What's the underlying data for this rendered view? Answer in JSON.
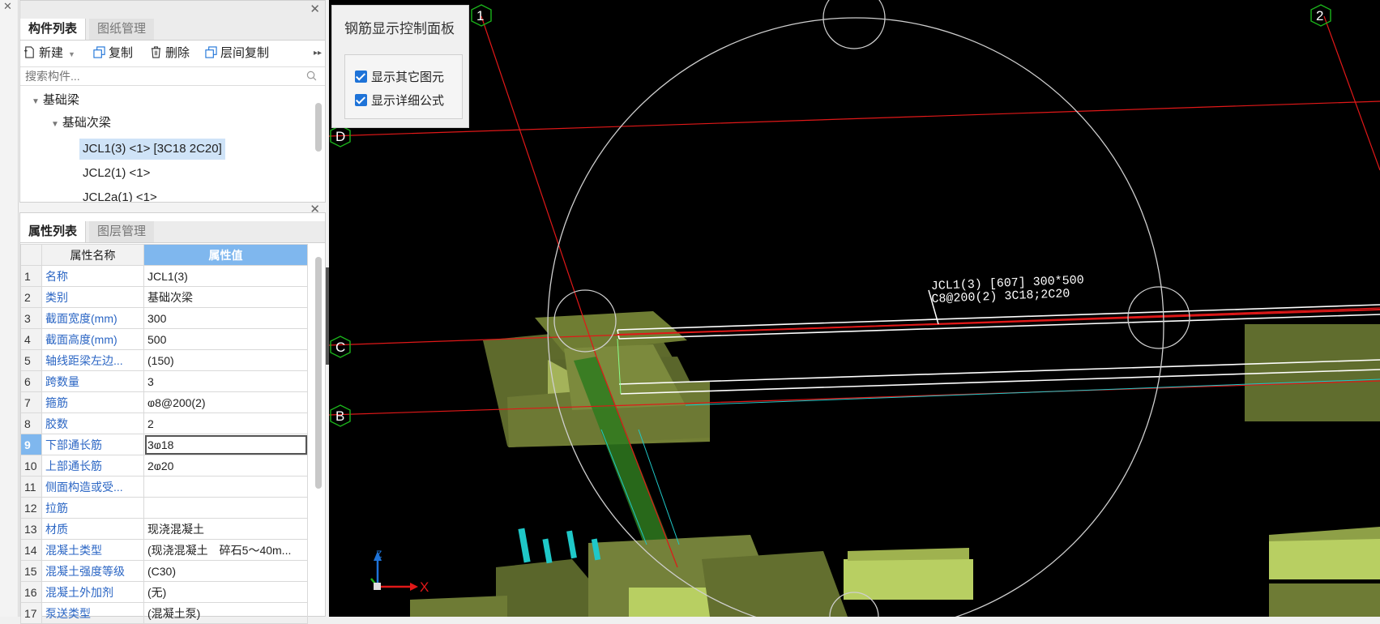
{
  "component_panel": {
    "tabs": [
      "构件列表",
      "图纸管理"
    ],
    "toolbar": {
      "new_label": "新建",
      "copy_label": "复制",
      "delete_label": "删除",
      "floor_copy_label": "层间复制"
    },
    "search_placeholder": "搜索构件...",
    "tree": {
      "root": "基础梁",
      "child": "基础次梁",
      "items": [
        "JCL1(3) <1> [3C18 2C20]",
        "JCL2(1) <1>",
        "JCL2a(1) <1>"
      ]
    }
  },
  "property_panel": {
    "tabs": [
      "属性列表",
      "图层管理"
    ],
    "col_name": "属性名称",
    "col_value": "属性值",
    "selected_row": 9,
    "rows": [
      {
        "n": "1",
        "name": "名称",
        "value": "JCL1(3)"
      },
      {
        "n": "2",
        "name": "类别",
        "value": "基础次梁"
      },
      {
        "n": "3",
        "name": "截面宽度(mm)",
        "value": "300"
      },
      {
        "n": "4",
        "name": "截面高度(mm)",
        "value": "500"
      },
      {
        "n": "5",
        "name": "轴线距梁左边...",
        "value": "(150)"
      },
      {
        "n": "6",
        "name": "跨数量",
        "value": "3"
      },
      {
        "n": "7",
        "name": "箍筋",
        "value": "ⱷ8@200(2)"
      },
      {
        "n": "8",
        "name": "胶数",
        "value": "2"
      },
      {
        "n": "9",
        "name": "下部通长筋",
        "value": "3ⱷ18"
      },
      {
        "n": "10",
        "name": "上部通长筋",
        "value": "2ⱷ20"
      },
      {
        "n": "11",
        "name": "侧面构造或受...",
        "value": ""
      },
      {
        "n": "12",
        "name": "拉筋",
        "value": ""
      },
      {
        "n": "13",
        "name": "材质",
        "value": "现浇混凝土"
      },
      {
        "n": "14",
        "name": "混凝土类型",
        "value": "(现浇混凝土　碎石5～40m..."
      },
      {
        "n": "15",
        "name": "混凝土强度等级",
        "value": "(C30)"
      },
      {
        "n": "16",
        "name": "混凝土外加剂",
        "value": "(无)"
      },
      {
        "n": "17",
        "name": "泵送类型",
        "value": "(混凝土泵)"
      }
    ]
  },
  "control_panel": {
    "title": "钢筋显示控制面板",
    "checkbox1": "显示其它图元",
    "checkbox2": "显示详细公式"
  },
  "viewport": {
    "axis_labels": [
      "1",
      "2",
      "D",
      "C",
      "B"
    ],
    "beam_label_line1": "JCL1(3) [607] 300*500",
    "beam_label_line2": "C8@200(2) 3C18;2C20",
    "axis_x": "X",
    "axis_z": "Z",
    "colors": {
      "grid_line": "#e01818",
      "bubble": "#1bb31b",
      "slab": "#7d8a3a",
      "slab_top": "#b8cf62"
    }
  }
}
